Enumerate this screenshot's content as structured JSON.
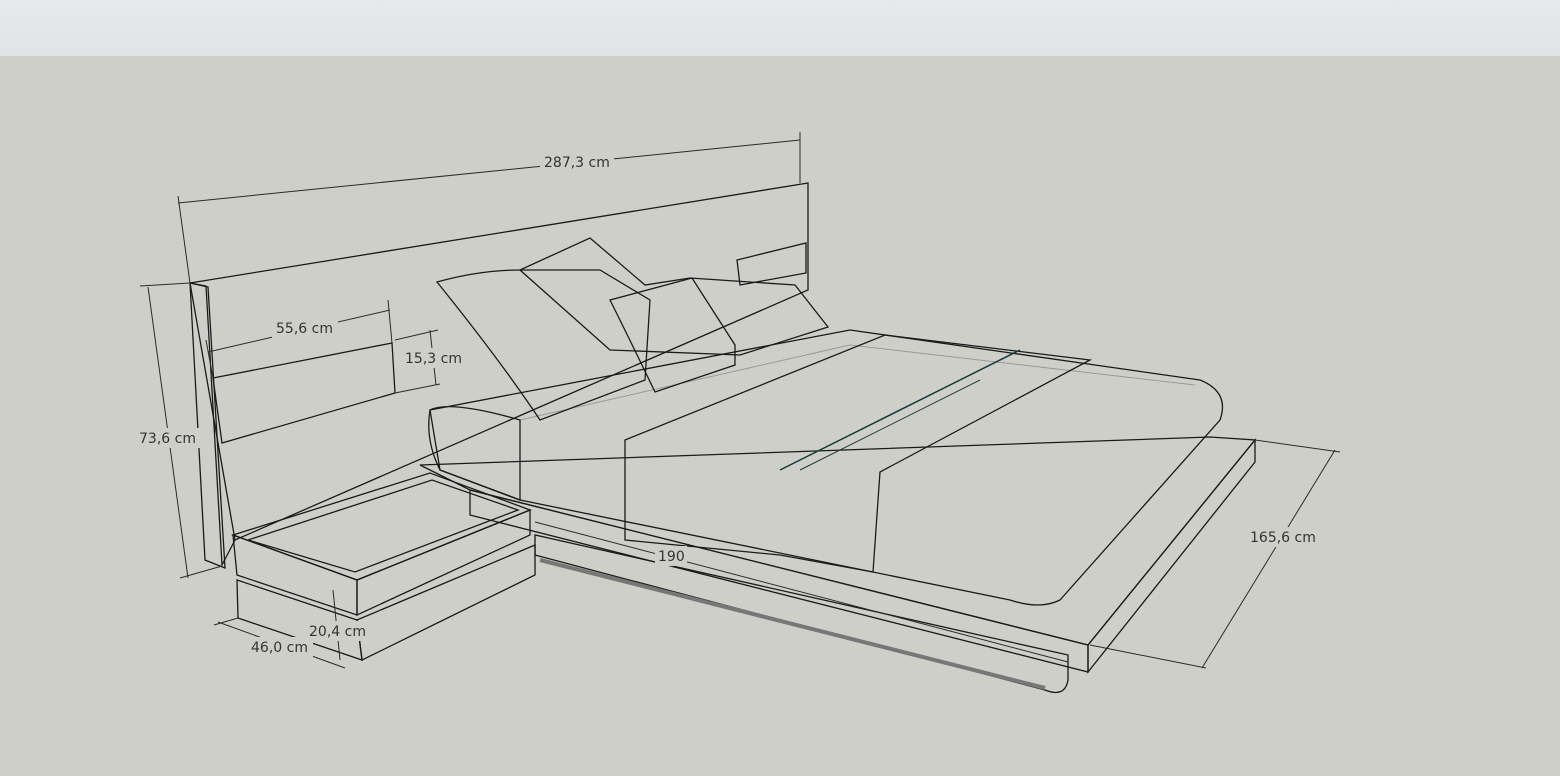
{
  "viewport": {
    "sky_color": "#e4e6e8",
    "ground_color": "#cfcfca"
  },
  "model": {
    "colors": {
      "headboard": "#d7d7d7",
      "panel": "#2b2b2b",
      "mattress": "#c9c9c9",
      "blanket": "#2a6b67",
      "frame": "#bdbdbd",
      "nightstand": "#dedede",
      "nightstand_top": "#6a6a6a"
    }
  },
  "dimensions": {
    "headboard_width": "287,3 cm",
    "headboard_height": "73,6 cm",
    "panel_width": "55,6 cm",
    "panel_height": "15,3 cm",
    "bed_length": "190",
    "bed_width": "165,6 cm",
    "nightstand_depth": "46,0 cm",
    "nightstand_height": "20,4 cm"
  }
}
